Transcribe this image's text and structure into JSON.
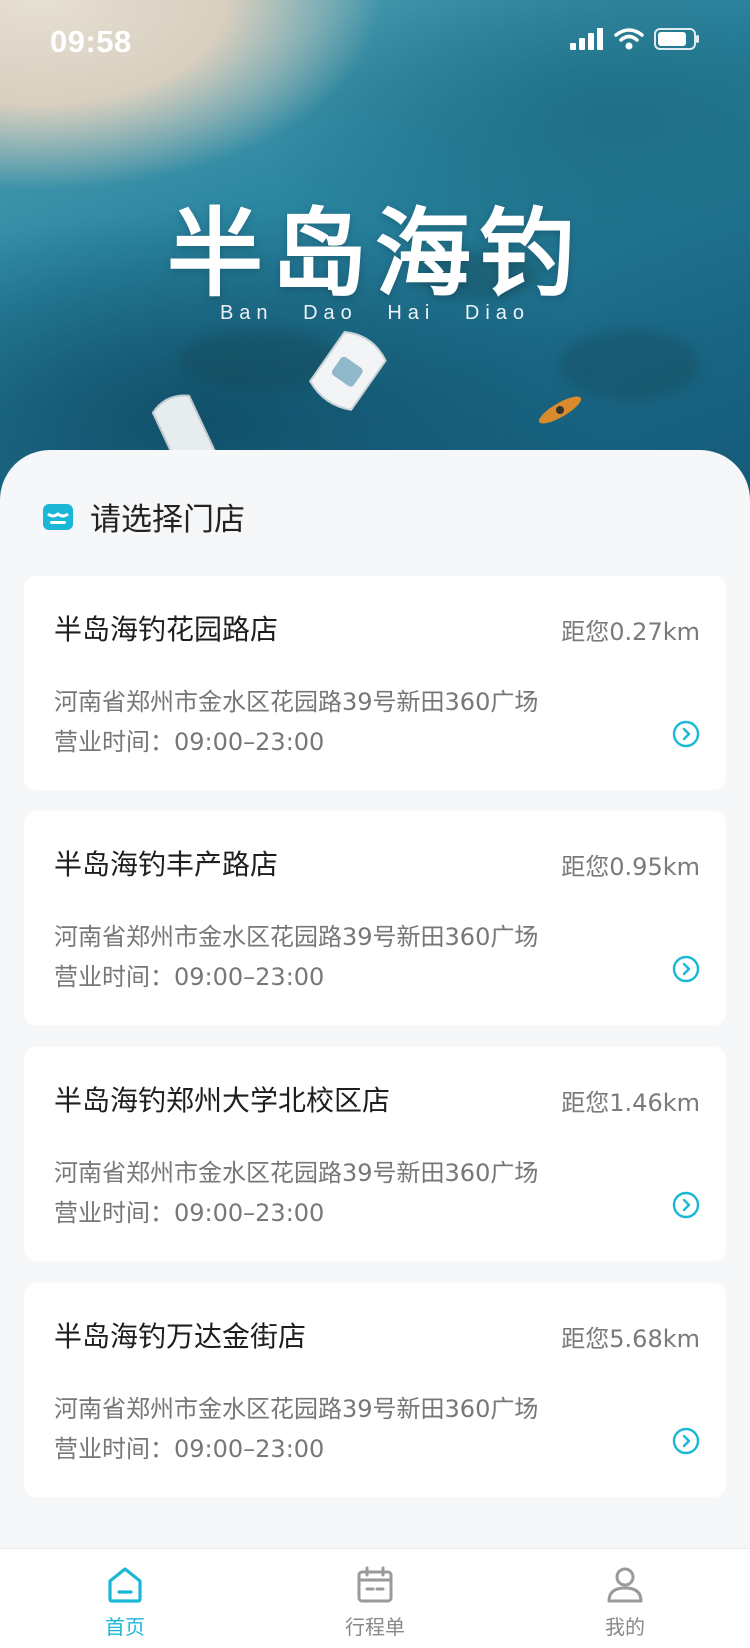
{
  "status_bar": {
    "time": "09:58"
  },
  "hero": {
    "title": "半岛海钓",
    "pinyin": "Ban Dao Hai Diao"
  },
  "section": {
    "title": "请选择门店"
  },
  "stores": [
    {
      "name": "半岛海钓花园路店",
      "distance": "距您0.27km",
      "address": "河南省郑州市金水区花园路39号新田360广场",
      "hours": "营业时间：09:00–23:00"
    },
    {
      "name": "半岛海钓丰产路店",
      "distance": "距您0.95km",
      "address": "河南省郑州市金水区花园路39号新田360广场",
      "hours": "营业时间：09:00–23:00"
    },
    {
      "name": "半岛海钓郑州大学北校区店",
      "distance": "距您1.46km",
      "address": "河南省郑州市金水区花园路39号新田360广场",
      "hours": "营业时间：09:00–23:00"
    },
    {
      "name": "半岛海钓万达金街店",
      "distance": "距您5.68km",
      "address": "河南省郑州市金水区花园路39号新田360广场",
      "hours": "营业时间：09:00–23:00"
    }
  ],
  "tab_bar": {
    "items": [
      {
        "label": "首页",
        "icon": "home-icon",
        "active": true
      },
      {
        "label": "行程单",
        "icon": "calendar-icon",
        "active": false
      },
      {
        "label": "我的",
        "icon": "user-icon",
        "active": false
      }
    ]
  },
  "colors": {
    "accent": "#1ab8d6",
    "background": "#f6f7f8",
    "card": "#ffffff"
  }
}
